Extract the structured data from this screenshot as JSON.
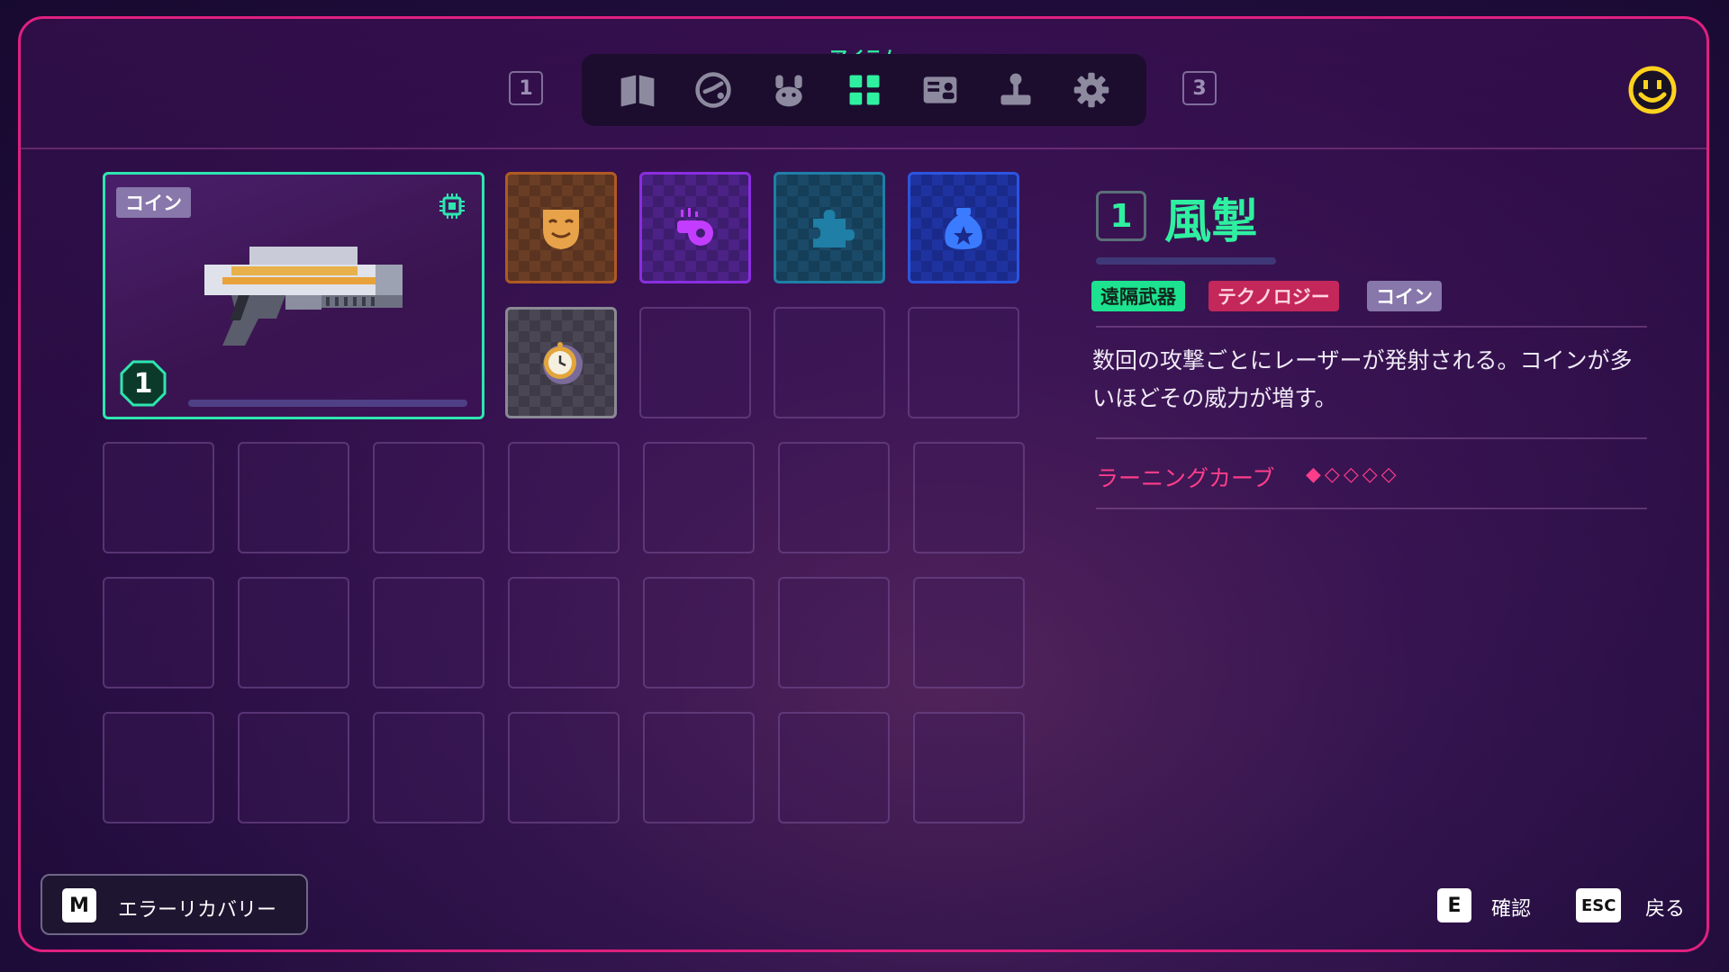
{
  "header": {
    "page_left": "1",
    "page_right": "3",
    "active_tab_label": "アイテム",
    "tabs": [
      {
        "icon": "book-icon"
      },
      {
        "icon": "gauge-icon"
      },
      {
        "icon": "paw-icon"
      },
      {
        "icon": "grid-icon",
        "active": true
      },
      {
        "icon": "profile-card-icon"
      },
      {
        "icon": "joystick-icon"
      },
      {
        "icon": "gear-icon"
      }
    ],
    "profile_icon": "smiley-icon"
  },
  "selected_item": {
    "tag": "コイン",
    "level": "1",
    "icon": "laser-gun-icon"
  },
  "inventory": {
    "items": [
      {
        "icon": "mask-icon",
        "border": "#b05a23"
      },
      {
        "icon": "whistle-icon",
        "border": "#8a2ee0"
      },
      {
        "icon": "puzzle-icon",
        "border": "#1e7fa8"
      },
      {
        "icon": "money-bag-icon",
        "border": "#2a55e0"
      },
      {
        "icon": "pocket-watch-icon",
        "border": "#8a8a94"
      }
    ]
  },
  "detail": {
    "level": "1",
    "name": "風掣",
    "tags": {
      "ranged": "遠隔武器",
      "tech": "テクノロジー",
      "coin": "コイン"
    },
    "description": "数回の攻撃ごとにレーザーが発射される。コインが多いほどその威力が増す。",
    "learning_curve_label": "ラーニングカーブ",
    "learning_curve_rating": "◆◇◇◇◇",
    "learning_curve_value": 1,
    "learning_curve_max": 5
  },
  "footer": {
    "error_key": "M",
    "error_label": "エラーリカバリー",
    "confirm_key": "E",
    "confirm_label": "確認",
    "back_key": "ESC",
    "back_label": "戻る"
  },
  "colors": {
    "accent_green": "#2ef0a0",
    "frame_pink": "#e0207f",
    "curve_pink": "#ff3d8a"
  }
}
